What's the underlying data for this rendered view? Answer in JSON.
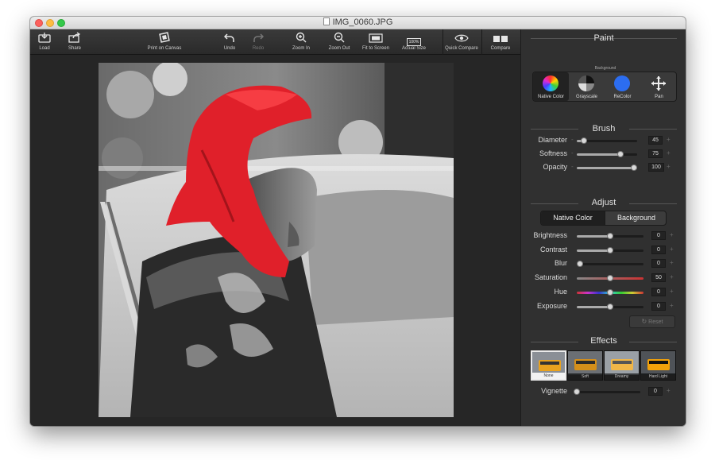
{
  "window": {
    "title": "IMG_0060.JPG"
  },
  "toolbar": {
    "load": "Load",
    "share": "Share",
    "print": "Print on Canvas",
    "undo": "Undo",
    "redo": "Redo",
    "zoom_in": "Zoom In",
    "zoom_out": "Zoom Out",
    "fit": "Fit to Screen",
    "actual": "Actual Size",
    "actual_badge": "100%",
    "quick_compare": "Quick Compare",
    "compare": "Compare"
  },
  "paint": {
    "title": "Paint",
    "background_caption": "Background",
    "modes": [
      {
        "label": "Native Color",
        "selected": true
      },
      {
        "label": "Grayscale",
        "selected": false
      },
      {
        "label": "ReColor",
        "selected": false
      },
      {
        "label": "Pan",
        "selected": false
      }
    ]
  },
  "brush": {
    "title": "Brush",
    "sliders": [
      {
        "label": "Diameter",
        "value": "45",
        "level": 0.08
      },
      {
        "label": "Softness",
        "value": "75",
        "level": 0.75
      },
      {
        "label": "Opacity",
        "value": "100",
        "level": 1.0
      }
    ]
  },
  "adjust": {
    "title": "Adjust",
    "tabs": [
      "Native Color",
      "Background"
    ],
    "active_tab": 0,
    "sliders": [
      {
        "label": "Brightness",
        "value": "0",
        "level": 0.5
      },
      {
        "label": "Contrast",
        "value": "0",
        "level": 0.5
      },
      {
        "label": "Blur",
        "value": "0",
        "level": 0.0
      },
      {
        "label": "Saturation",
        "value": "50",
        "level": 0.5
      },
      {
        "label": "Hue",
        "value": "0",
        "level": 0.5
      },
      {
        "label": "Exposure",
        "value": "0",
        "level": 0.5
      }
    ],
    "reset": "Reset"
  },
  "effects": {
    "title": "Effects",
    "items": [
      {
        "label": "None",
        "selected": true
      },
      {
        "label": "Soft",
        "selected": false
      },
      {
        "label": "Dreamy",
        "selected": false
      },
      {
        "label": "Hard Light",
        "selected": false
      }
    ],
    "vignette": {
      "label": "Vignette",
      "value": "0",
      "level": 0.0
    }
  },
  "colors": {
    "headscarf": "#e0202a",
    "recolor": "#2c6df0"
  }
}
